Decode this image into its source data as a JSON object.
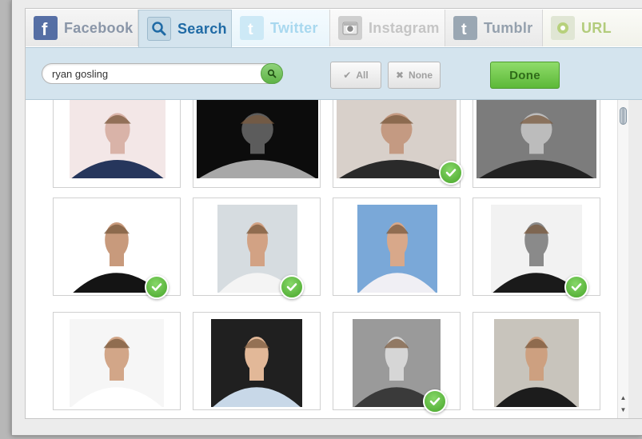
{
  "tabs": [
    {
      "label": "Facebook",
      "icon": "facebook-icon",
      "active": false
    },
    {
      "label": "Search",
      "icon": "search-icon",
      "active": true
    },
    {
      "label": "Twitter",
      "icon": "twitter-icon",
      "active": false
    },
    {
      "label": "Instagram",
      "icon": "instagram-icon",
      "active": false
    },
    {
      "label": "Tumblr",
      "icon": "tumblr-icon",
      "active": false
    },
    {
      "label": "URL",
      "icon": "url-icon",
      "active": false
    }
  ],
  "search": {
    "value": "ryan gosling",
    "placeholder": ""
  },
  "toolbar": {
    "select_all_label": "All",
    "select_none_label": "None",
    "done_label": "Done"
  },
  "photos": [
    {
      "selected": false
    },
    {
      "selected": false
    },
    {
      "selected": true
    },
    {
      "selected": false
    },
    {
      "selected": true
    },
    {
      "selected": true
    },
    {
      "selected": false
    },
    {
      "selected": true
    },
    {
      "selected": false
    },
    {
      "selected": false
    },
    {
      "selected": true
    },
    {
      "selected": false
    }
  ],
  "colors": {
    "accent_blue": "#1f6aa5",
    "toolbar_bg": "#d4e4ee",
    "done_green": "#5cb838",
    "check_green": "#47a52a"
  }
}
